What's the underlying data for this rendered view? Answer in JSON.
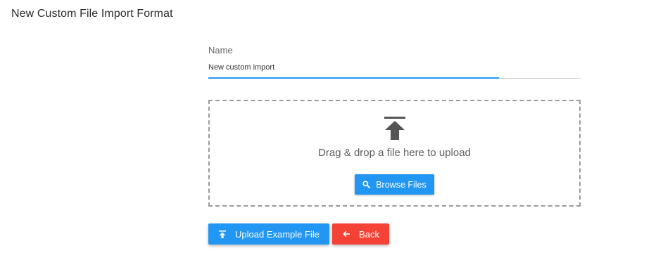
{
  "page": {
    "title": "New Custom File Import Format"
  },
  "name_field": {
    "label": "Name",
    "value": "New custom import"
  },
  "dropzone": {
    "icon": "upload-icon",
    "text": "Drag & drop a file here to upload",
    "browse_label": "Browse Files",
    "browse_icon": "search-icon"
  },
  "actions": {
    "upload_example_label": "Upload Example File",
    "upload_example_icon": "upload-icon",
    "back_label": "Back",
    "back_icon": "arrow-left-icon"
  },
  "colors": {
    "primary": "#2196f3",
    "danger": "#f44336",
    "border_dashed": "#9a9a9a",
    "text": "#2b2b2b"
  }
}
